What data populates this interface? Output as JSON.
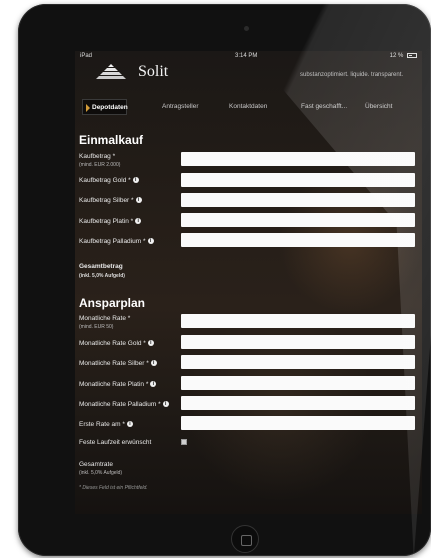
{
  "status": {
    "device": "iPad",
    "time": "3:14 PM",
    "battery": "12 %"
  },
  "header": {
    "brand": "Solit",
    "tagline": "substanzoptimiert. liquide. transparent."
  },
  "tabs": [
    {
      "label": "Depotdaten"
    },
    {
      "label": "Antragsteller"
    },
    {
      "label": "Kontaktdaten"
    },
    {
      "label": "Fast geschafft..."
    },
    {
      "label": "Übersicht"
    }
  ],
  "einmalkauf": {
    "heading": "Einmalkauf",
    "kaufbetrag_label": "Kaufbetrag *",
    "kaufbetrag_hint": "(mind. EUR 2.000)",
    "gold_label": "Kaufbetrag Gold *",
    "silber_label": "Kaufbetrag Silber *",
    "platin_label": "Kaufbetrag Platin *",
    "palladium_label": "Kaufbetrag Palladium *",
    "gesamt_label": "Gesamtbetrag",
    "gesamt_hint": "(inkl. 5,0% Aufgeld)"
  },
  "ansparplan": {
    "heading": "Ansparplan",
    "rate_label": "Monatliche Rate *",
    "rate_hint": "(mind. EUR 50)",
    "gold_label": "Monatliche Rate Gold *",
    "silber_label": "Monatliche Rate Silber *",
    "platin_label": "Monatliche Rate Platin *",
    "palladium_label": "Monatliche Rate Palladium *",
    "erste_rate_label": "Erste Rate am *",
    "laufzeit_label": "Feste Laufzeit erwünscht",
    "gesamtrate_label": "Gesamtrate",
    "gesamtrate_hint": "(inkl. 5,0% Aufgeld)",
    "pflicht_note": "* Dieses Feld ist ein Pflichtfeld."
  },
  "info_glyph": "i",
  "colors": {
    "accent": "#d29b38",
    "field_bg": "#fafafa"
  }
}
